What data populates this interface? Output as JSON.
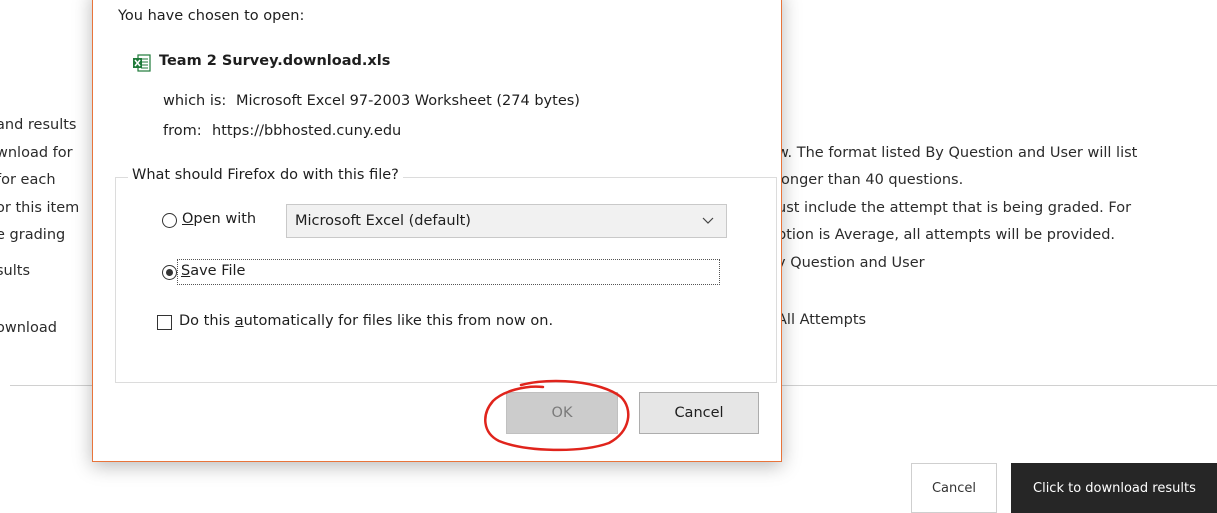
{
  "background": {
    "left_lines": [
      "and results",
      "wnload for",
      "for each",
      "or this item",
      "e grading",
      "sults",
      "ownload"
    ],
    "right_lines": [
      "w. The format listed By Question and User will list",
      "longer than 40 questions.",
      "ust include the attempt that is being graded. For",
      "ption is Average, all attempts will be provided.",
      "y Question and User",
      "All Attempts"
    ],
    "buttons": {
      "cancel": "Cancel",
      "download": "Click to download results"
    }
  },
  "dialog": {
    "heading": "You have chosen to open:",
    "file_name": "Team 2 Survey.download.xls",
    "which_is_label": "which is:",
    "which_is_value": "Microsoft Excel 97-2003 Worksheet (274 bytes)",
    "from_label": "from:",
    "from_value": "https://bbhosted.cuny.edu",
    "group_title": "What should Firefox do with this file?",
    "open_with": {
      "label_first": "O",
      "label_rest": "pen with",
      "selected_app": "Microsoft Excel (default)",
      "checked": false
    },
    "save_file": {
      "label_first": "S",
      "label_rest": "ave File",
      "checked": true
    },
    "auto": {
      "label_before": "Do this ",
      "label_underlined": "a",
      "label_after": "utomatically for files like this from now on.",
      "checked": false
    },
    "ok_label": "OK",
    "cancel_label": "Cancel"
  },
  "colors": {
    "dialog_border": "#e8743b",
    "annotation": "#e0241c",
    "dark_button": "#262626"
  },
  "icons": [
    "excel-file-icon",
    "chevron-down-icon"
  ]
}
